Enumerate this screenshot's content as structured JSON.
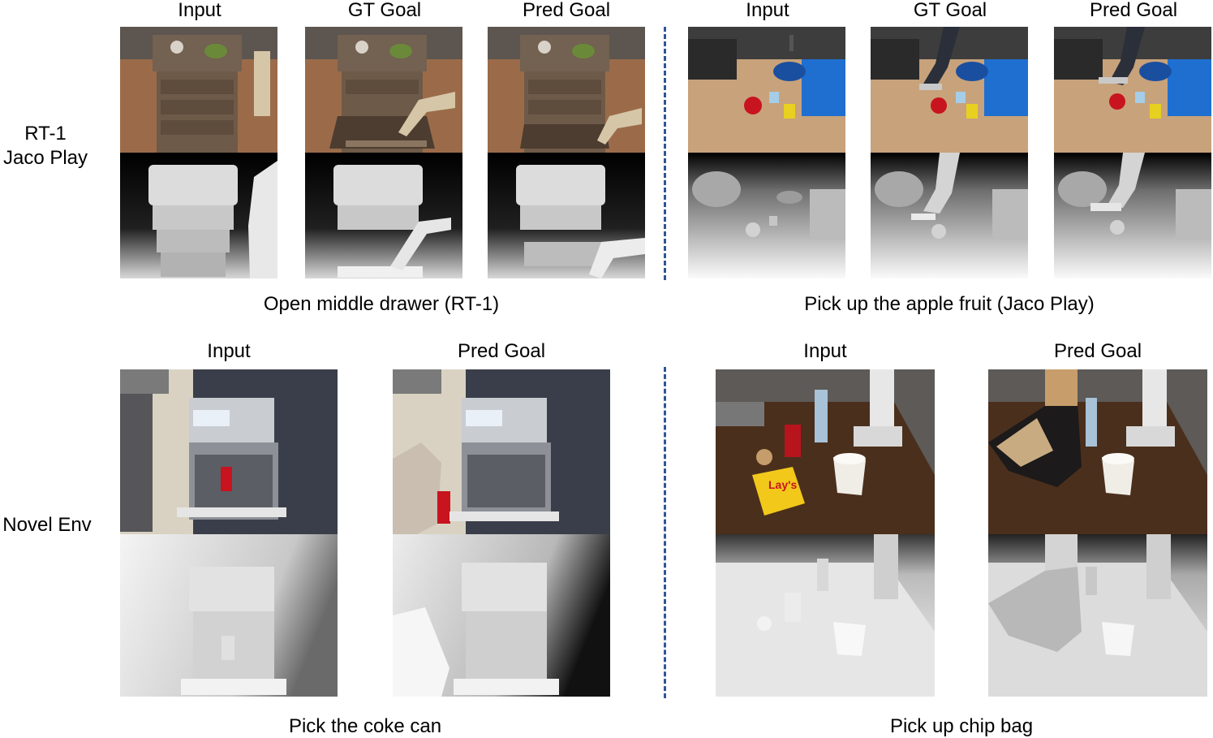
{
  "rows": {
    "top_label_line1": "RT-1",
    "top_label_line2": "Jaco Play",
    "bottom_label": "Novel Env"
  },
  "column_headers": {
    "input": "Input",
    "gt_goal": "GT Goal",
    "pred_goal": "Pred Goal"
  },
  "captions": {
    "top_left": "Open middle drawer (RT-1)",
    "top_right": "Pick up the apple fruit (Jaco Play)",
    "bottom_left": "Pick the coke can",
    "bottom_right": "Pick up chip bag"
  },
  "embedded_text": {
    "chip_brand": "Lay's"
  },
  "colors": {
    "divider": "#2f5597",
    "desk_wood": "#6e5a48",
    "floor_carpet": "#9b6b49",
    "table_wood": "#c8a27a",
    "bowl_blue": "#1f6fd1",
    "apple_red": "#c8141e",
    "dark_table": "#4a2f1c",
    "chip_yellow": "#f2c81b"
  }
}
